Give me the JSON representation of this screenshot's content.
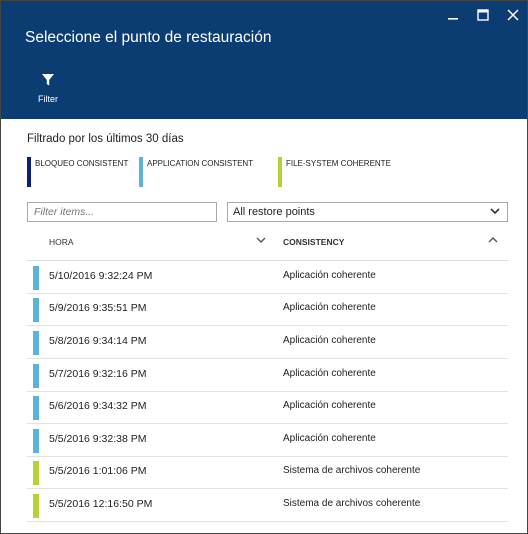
{
  "window": {
    "title": "Seleccione el punto de restauración",
    "controls": [
      "minimize-icon",
      "maximize-icon",
      "close-icon"
    ]
  },
  "toolbar": {
    "filter_label": "Filter",
    "filter_icon": "filter-funnel-icon"
  },
  "subtitle": "Filtrado por los últimos 30 días",
  "legend": [
    {
      "label": "BLOQUEO CONSISTENT",
      "color": "#0a1f7a"
    },
    {
      "label": "APPLICATION CONSISTENT",
      "color": "#5bb4d8"
    },
    {
      "label": "FILE-SYSTEM COHERENTE",
      "color": "#b5d334"
    }
  ],
  "filter": {
    "placeholder": "Filter items..."
  },
  "restore_select": {
    "value": "All restore points"
  },
  "table": {
    "columns": [
      "HORA",
      "CONSISTENCY"
    ],
    "rows": [
      {
        "time": "5/10/2016 9:32:24 PM",
        "consistency": "Aplicación coherente",
        "color": "#5bb4d8"
      },
      {
        "time": "5/9/2016 9:35:51 PM",
        "consistency": "Aplicación coherente",
        "color": "#5bb4d8"
      },
      {
        "time": "5/8/2016 9:34:14 PM",
        "consistency": "Aplicación coherente",
        "color": "#5bb4d8"
      },
      {
        "time": "5/7/2016 9:32:16 PM",
        "consistency": "Aplicación coherente",
        "color": "#5bb4d8"
      },
      {
        "time": "5/6/2016 9:34:32 PM",
        "consistency": "Aplicación coherente",
        "color": "#5bb4d8"
      },
      {
        "time": "5/5/2016 9:32:38 PM",
        "consistency": "Aplicación coherente",
        "color": "#5bb4d8"
      },
      {
        "time": "5/5/2016 1:01:06 PM",
        "consistency": "Sistema de archivos coherente",
        "color": "#b5d334"
      },
      {
        "time": "5/5/2016 12:16:50 PM",
        "consistency": "Sistema de archivos coherente",
        "color": "#b5d334"
      }
    ]
  }
}
